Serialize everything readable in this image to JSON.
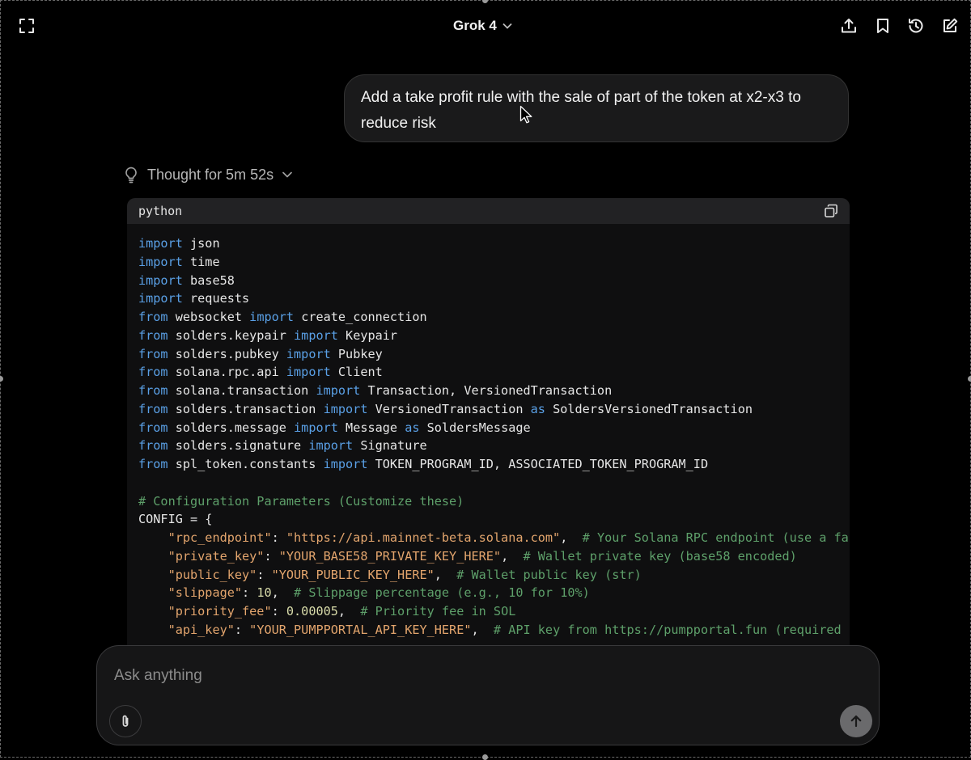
{
  "header": {
    "model_name": "Grok 4",
    "icons": [
      "fullscreen-icon",
      "chevron-down-icon",
      "share-icon",
      "bookmark-icon",
      "history-icon",
      "edit-icon"
    ]
  },
  "user_message": {
    "text": "Add a take profit rule with the sale of part of the token at x2-x3 to reduce risk"
  },
  "thought": {
    "label": "Thought for 5m 52s",
    "icon": "lightbulb-icon"
  },
  "code_block": {
    "language": "python",
    "copy_icon": "copy-icon",
    "lines": [
      [
        {
          "t": "import",
          "c": "kw"
        },
        {
          "t": " json"
        }
      ],
      [
        {
          "t": "import",
          "c": "kw"
        },
        {
          "t": " time"
        }
      ],
      [
        {
          "t": "import",
          "c": "kw"
        },
        {
          "t": " base58"
        }
      ],
      [
        {
          "t": "import",
          "c": "kw"
        },
        {
          "t": " requests"
        }
      ],
      [
        {
          "t": "from",
          "c": "kw"
        },
        {
          "t": " websocket "
        },
        {
          "t": "import",
          "c": "kw"
        },
        {
          "t": " create_connection"
        }
      ],
      [
        {
          "t": "from",
          "c": "kw"
        },
        {
          "t": " solders.keypair "
        },
        {
          "t": "import",
          "c": "kw"
        },
        {
          "t": " Keypair"
        }
      ],
      [
        {
          "t": "from",
          "c": "kw"
        },
        {
          "t": " solders.pubkey "
        },
        {
          "t": "import",
          "c": "kw"
        },
        {
          "t": " Pubkey"
        }
      ],
      [
        {
          "t": "from",
          "c": "kw"
        },
        {
          "t": " solana.rpc.api "
        },
        {
          "t": "import",
          "c": "kw"
        },
        {
          "t": " Client"
        }
      ],
      [
        {
          "t": "from",
          "c": "kw"
        },
        {
          "t": " solana.transaction "
        },
        {
          "t": "import",
          "c": "kw"
        },
        {
          "t": " Transaction, VersionedTransaction"
        }
      ],
      [
        {
          "t": "from",
          "c": "kw"
        },
        {
          "t": " solders.transaction "
        },
        {
          "t": "import",
          "c": "kw"
        },
        {
          "t": " VersionedTransaction "
        },
        {
          "t": "as",
          "c": "kw"
        },
        {
          "t": " SoldersVersionedTransaction"
        }
      ],
      [
        {
          "t": "from",
          "c": "kw"
        },
        {
          "t": " solders.message "
        },
        {
          "t": "import",
          "c": "kw"
        },
        {
          "t": " Message "
        },
        {
          "t": "as",
          "c": "kw"
        },
        {
          "t": " SoldersMessage"
        }
      ],
      [
        {
          "t": "from",
          "c": "kw"
        },
        {
          "t": " solders.signature "
        },
        {
          "t": "import",
          "c": "kw"
        },
        {
          "t": " Signature"
        }
      ],
      [
        {
          "t": "from",
          "c": "kw"
        },
        {
          "t": " spl_token.constants "
        },
        {
          "t": "import",
          "c": "kw"
        },
        {
          "t": " TOKEN_PROGRAM_ID, ASSOCIATED_TOKEN_PROGRAM_ID"
        }
      ],
      [],
      [
        {
          "t": "# Configuration Parameters (Customize these)",
          "c": "com"
        }
      ],
      [
        {
          "t": "CONFIG = {"
        }
      ],
      [
        {
          "t": "    "
        },
        {
          "t": "\"rpc_endpoint\"",
          "c": "str"
        },
        {
          "t": ": "
        },
        {
          "t": "\"https://api.mainnet-beta.solana.com\"",
          "c": "str"
        },
        {
          "t": ",  "
        },
        {
          "t": "# Your Solana RPC endpoint (use a fas",
          "c": "com"
        }
      ],
      [
        {
          "t": "    "
        },
        {
          "t": "\"private_key\"",
          "c": "str"
        },
        {
          "t": ": "
        },
        {
          "t": "\"YOUR_BASE58_PRIVATE_KEY_HERE\"",
          "c": "str"
        },
        {
          "t": ",  "
        },
        {
          "t": "# Wallet private key (base58 encoded)",
          "c": "com"
        }
      ],
      [
        {
          "t": "    "
        },
        {
          "t": "\"public_key\"",
          "c": "str"
        },
        {
          "t": ": "
        },
        {
          "t": "\"YOUR_PUBLIC_KEY_HERE\"",
          "c": "str"
        },
        {
          "t": ",  "
        },
        {
          "t": "# Wallet public key (str)",
          "c": "com"
        }
      ],
      [
        {
          "t": "    "
        },
        {
          "t": "\"slippage\"",
          "c": "str"
        },
        {
          "t": ": "
        },
        {
          "t": "10",
          "c": "num"
        },
        {
          "t": ",  "
        },
        {
          "t": "# Slippage percentage (e.g., 10 for 10%)",
          "c": "com"
        }
      ],
      [
        {
          "t": "    "
        },
        {
          "t": "\"priority_fee\"",
          "c": "str"
        },
        {
          "t": ": "
        },
        {
          "t": "0.00005",
          "c": "num"
        },
        {
          "t": ",  "
        },
        {
          "t": "# Priority fee in SOL",
          "c": "com"
        }
      ],
      [
        {
          "t": "    "
        },
        {
          "t": "\"api_key\"",
          "c": "str"
        },
        {
          "t": ": "
        },
        {
          "t": "\"YOUR_PUMPPORTAL_API_KEY_HERE\"",
          "c": "str"
        },
        {
          "t": ",  "
        },
        {
          "t": "# API key from https://pumpportal.fun (required f",
          "c": "com"
        }
      ]
    ]
  },
  "composer": {
    "placeholder": "Ask anything",
    "value": "",
    "attach_icon": "paperclip-icon",
    "send_icon": "arrow-up-icon"
  }
}
